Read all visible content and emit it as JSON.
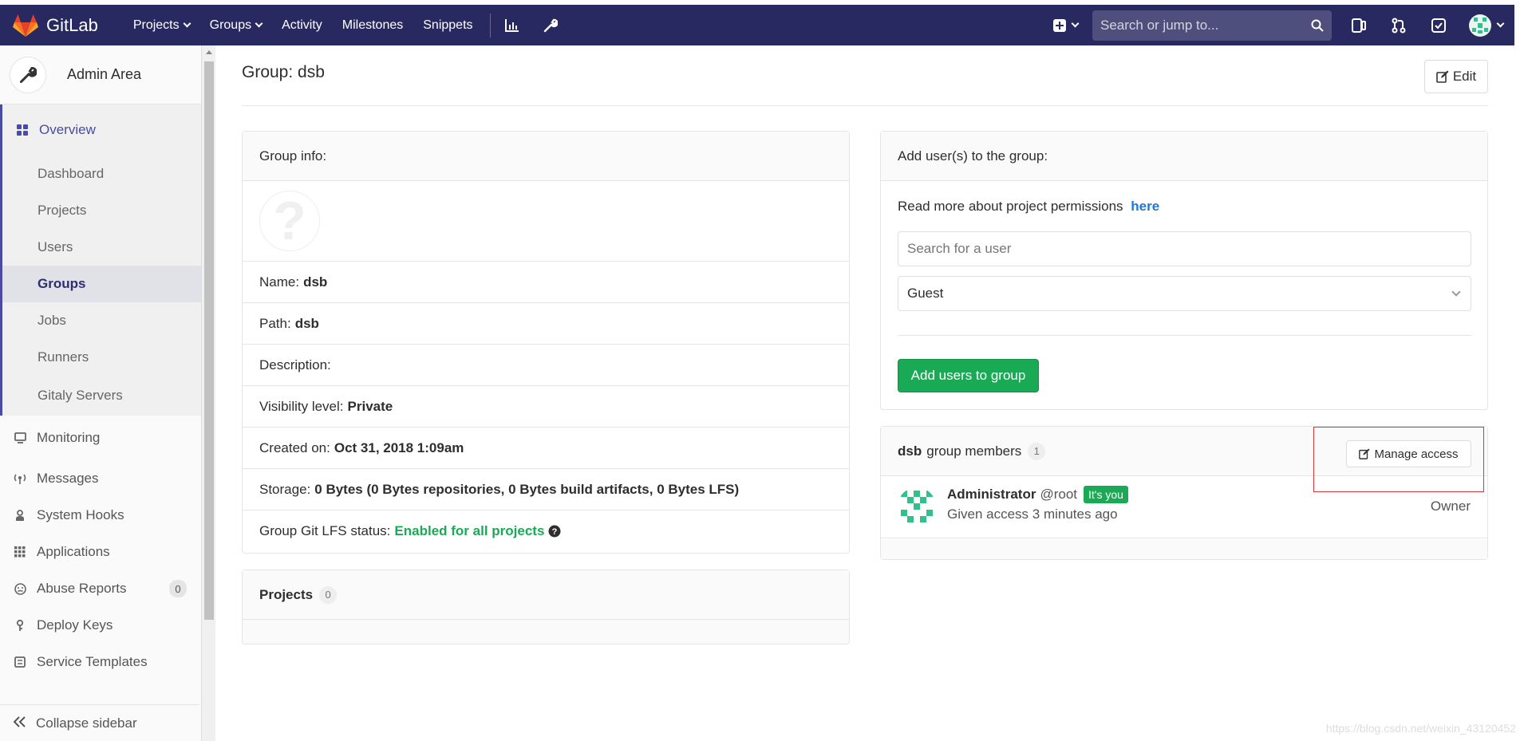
{
  "navbar": {
    "brand": "GitLab",
    "links": [
      {
        "label": "Projects",
        "has_caret": true
      },
      {
        "label": "Groups",
        "has_caret": true
      },
      {
        "label": "Activity",
        "has_caret": false
      },
      {
        "label": "Milestones",
        "has_caret": false
      },
      {
        "label": "Snippets",
        "has_caret": false
      }
    ],
    "search_placeholder": "Search or jump to...",
    "icons": [
      "chart-icon",
      "wrench-icon",
      "plus-icon",
      "search-icon",
      "todo-sidebar-icon",
      "merge-request-icon",
      "todo-check-icon",
      "avatar"
    ]
  },
  "sidebar": {
    "title": "Admin Area",
    "overview_label": "Overview",
    "sub_items": [
      "Dashboard",
      "Projects",
      "Users",
      "Groups",
      "Jobs",
      "Runners",
      "Gitaly Servers"
    ],
    "active_sub": "Groups",
    "items": [
      {
        "label": "Monitoring",
        "icon": "monitor-icon"
      },
      {
        "label": "Messages",
        "icon": "broadcast-icon"
      },
      {
        "label": "System Hooks",
        "icon": "hook-icon"
      },
      {
        "label": "Applications",
        "icon": "grid-icon"
      },
      {
        "label": "Abuse Reports",
        "icon": "smiley-icon",
        "badge": "0"
      },
      {
        "label": "Deploy Keys",
        "icon": "key-icon"
      },
      {
        "label": "Service Templates",
        "icon": "template-icon"
      }
    ],
    "collapse_label": "Collapse sidebar"
  },
  "page": {
    "title": "Group: dsb",
    "edit_label": "Edit"
  },
  "group_info": {
    "heading": "Group info:",
    "name_label": "Name:",
    "name_value": "dsb",
    "path_label": "Path:",
    "path_value": "dsb",
    "description_label": "Description:",
    "visibility_label": "Visibility level:",
    "visibility_value": "Private",
    "created_label": "Created on:",
    "created_value": "Oct 31, 2018 1:09am",
    "storage_label": "Storage:",
    "storage_value": "0 Bytes (0 Bytes repositories, 0 Bytes build artifacts, 0 Bytes LFS)",
    "lfs_label": "Group Git LFS status:",
    "lfs_value": "Enabled for all projects"
  },
  "projects_panel": {
    "heading": "Projects",
    "count": "0"
  },
  "add_users": {
    "heading": "Add user(s) to the group:",
    "permissions_text": "Read more about project permissions",
    "permissions_link": "here",
    "search_placeholder": "Search for a user",
    "role_value": "Guest",
    "submit_label": "Add users to group"
  },
  "members": {
    "group_name": "dsb",
    "heading_suffix": "group members",
    "count": "1",
    "manage_label": "Manage access",
    "list": [
      {
        "name": "Administrator",
        "username": "@root",
        "badge": "It's you",
        "access_text": "Given access 3 minutes ago",
        "role": "Owner"
      }
    ]
  },
  "watermark": "https://blog.csdn.net/weixin_43120452",
  "colors": {
    "navbar": "#292961",
    "accent": "#4b4ba3",
    "green": "#1aaa55",
    "link": "#1f78d1",
    "highlight": "#e0363b"
  }
}
